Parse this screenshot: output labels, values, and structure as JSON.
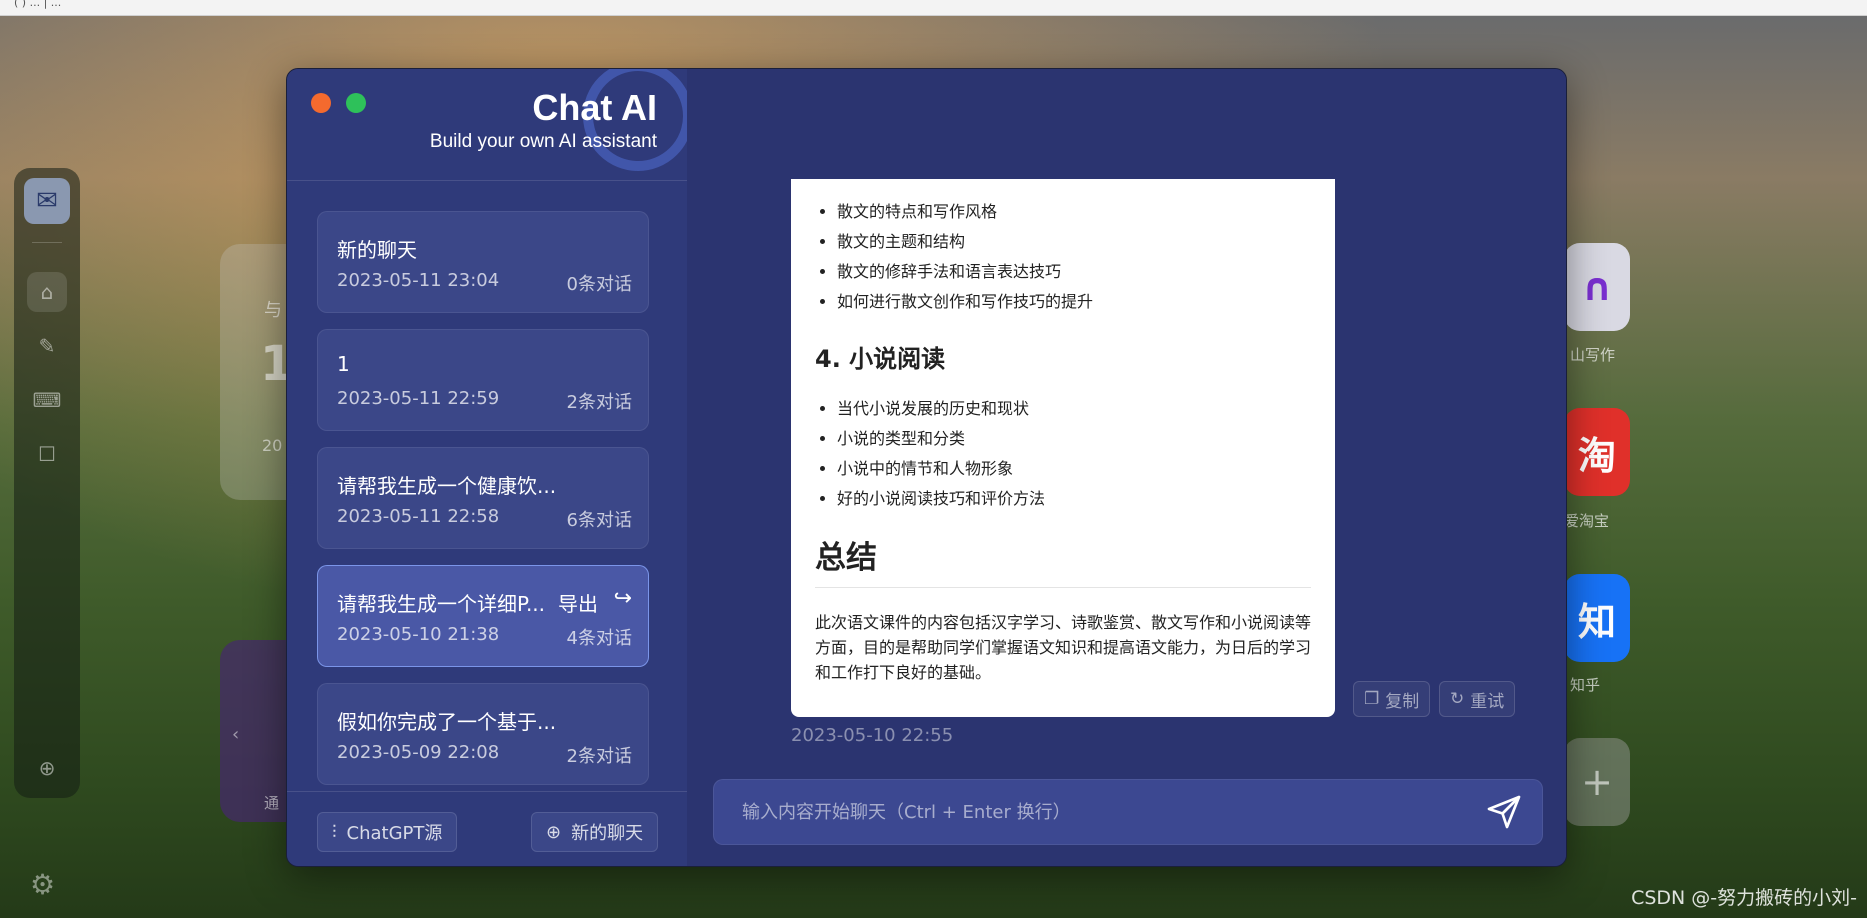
{
  "browser": {
    "tab_text": "( ) ... | ..."
  },
  "app": {
    "title": "Chat AI",
    "subtitle": "Build your own AI assistant"
  },
  "conversations": [
    {
      "title": "新的聊天",
      "date": "2023-05-11 23:04",
      "count": "0条对话"
    },
    {
      "title": "1",
      "date": "2023-05-11 22:59",
      "count": "2条对话"
    },
    {
      "title": "请帮我生成一个健康饮...",
      "date": "2023-05-11 22:58",
      "count": "6条对话"
    },
    {
      "title": "请帮我生成一个详细P...",
      "date": "2023-05-10 21:38",
      "count": "4条对话",
      "export_label": "导出",
      "active": true
    },
    {
      "title": "假如你完成了一个基于...",
      "date": "2023-05-09 22:08",
      "count": "2条对话"
    }
  ],
  "footer": {
    "source_label": "ChatGPT源",
    "new_chat_label": "新的聊天"
  },
  "message": {
    "list1": [
      "散文的特点和写作风格",
      "散文的主题和结构",
      "散文的修辞手法和语言表达技巧",
      "如何进行散文创作和写作技巧的提升"
    ],
    "heading1": "4. 小说阅读",
    "list2": [
      "当代小说发展的历史和现状",
      "小说的类型和分类",
      "小说中的情节和人物形象",
      "好的小说阅读技巧和评价方法"
    ],
    "heading2": "总结",
    "paragraph": "此次语文课件的内容包括汉字学习、诗歌鉴赏、散文写作和小说阅读等方面，目的是帮助同学们掌握语文知识和提高语文能力，为日后的学习和工作打下良好的基础。",
    "time": "2023-05-10 22:55",
    "copy_label": "复制",
    "retry_label": "重试"
  },
  "input": {
    "placeholder": "输入内容开始聊天（Ctrl + Enter 换行）"
  },
  "background": {
    "tiles": [
      {
        "glyph": "∩",
        "label": "山写作",
        "color": "#d9d9e3"
      },
      {
        "glyph": "淘",
        "label": "爱淘宝",
        "color": "#e0302a"
      },
      {
        "glyph": "知",
        "label": "知乎",
        "color": "#1772f6"
      },
      {
        "glyph": "+",
        "label": "",
        "color": "#8c8c8c"
      }
    ],
    "card_text": "与",
    "card_big": "1",
    "card_small": "20",
    "card2_text": "通"
  },
  "watermark": "CSDN @-努力搬砖的小刘-",
  "icons": {
    "send": "send-icon",
    "copy": "copy-icon",
    "retry": "refresh-icon",
    "export": "export-icon",
    "source": "sliders-icon",
    "new_chat": "plus-circle-icon",
    "settings": "gear-icon"
  },
  "colors": {
    "window_bg": "#2b3470",
    "sidebar_bg": "#2f3a7a",
    "card_bg": "#3b4788",
    "active_card_bg": "#4a58a6"
  }
}
